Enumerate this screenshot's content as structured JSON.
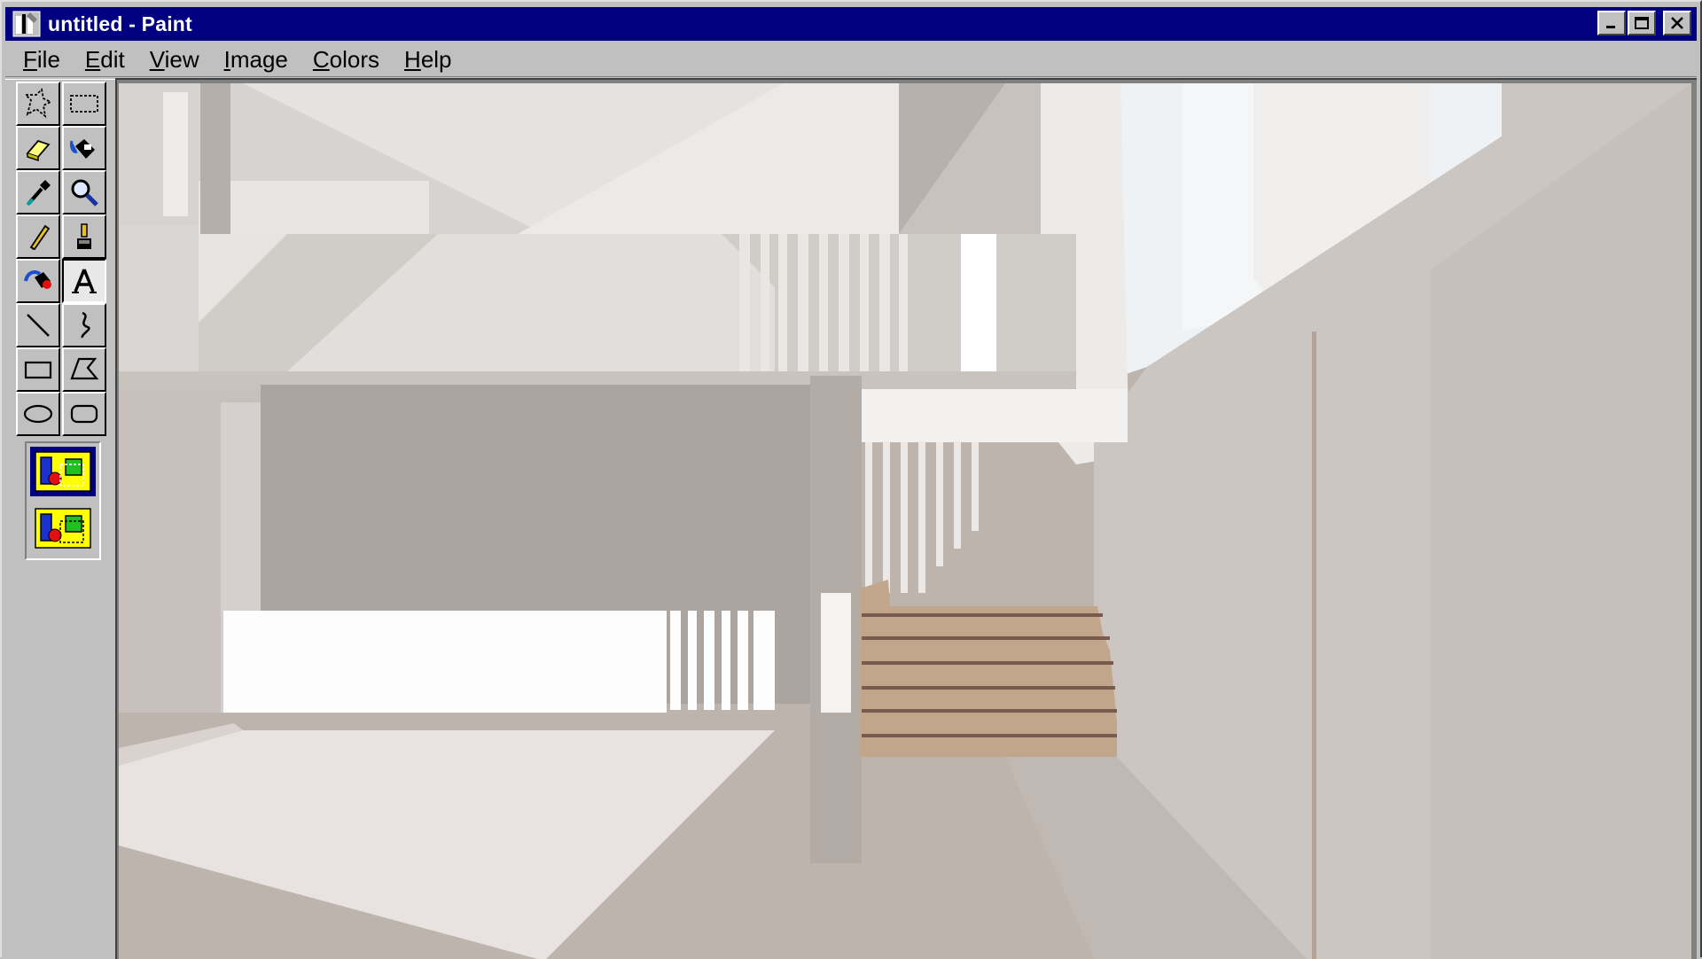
{
  "window": {
    "title": "untitled - Paint",
    "title_bar_color": "#000080"
  },
  "menu": [
    {
      "accel": "F",
      "rest": "ile"
    },
    {
      "accel": "E",
      "rest": "dit"
    },
    {
      "accel": "V",
      "rest": "iew"
    },
    {
      "accel": "I",
      "rest": "mage"
    },
    {
      "accel": "C",
      "rest": "olors"
    },
    {
      "accel": "H",
      "rest": "elp"
    }
  ],
  "tools": [
    "free-form-select-icon",
    "rect-select-icon",
    "eraser-icon",
    "fill-bucket-icon",
    "color-picker-icon",
    "magnifier-icon",
    "pencil-icon",
    "brush-icon",
    "airbrush-icon",
    "text-icon",
    "line-icon",
    "curve-icon",
    "rectangle-icon",
    "polygon-icon",
    "ellipse-icon",
    "rounded-rect-icon"
  ],
  "selected_tool": "text-icon",
  "tool_options": [
    "opaque-background-option",
    "transparent-background-option"
  ],
  "canvas": {
    "content": "painted interior scene",
    "background_color": "#bdb4ae",
    "accent_colors": {
      "wall": "#cfcac5",
      "stairs": "#c2a68b",
      "stair_lines": "#7a5a4c",
      "window_light": "#eef2f4"
    }
  }
}
